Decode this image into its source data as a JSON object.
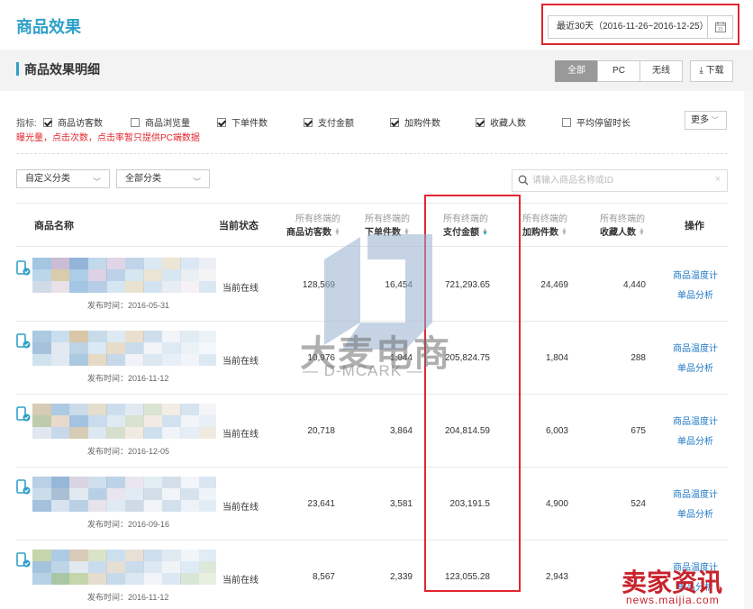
{
  "page_title": "商品效果",
  "date_range": "最近30天（2016-11-26~2016-12-25）",
  "section_title": "商品效果明细",
  "segment": {
    "all": "全部",
    "pc": "PC",
    "wireless": "无线"
  },
  "download_label": "下载",
  "indicators": {
    "label": "指标:",
    "items": [
      {
        "label": "商品访客数",
        "checked": true
      },
      {
        "label": "商品浏览量",
        "checked": false
      },
      {
        "label": "下单件数",
        "checked": true
      },
      {
        "label": "支付金额",
        "checked": true
      },
      {
        "label": "加购件数",
        "checked": true
      },
      {
        "label": "收藏人数",
        "checked": true
      },
      {
        "label": "平均停留时长",
        "checked": false
      }
    ],
    "more_label": "更多",
    "note": "曝光量，点击次数，点击率暂只提供PC端数据"
  },
  "filters": {
    "custom_category": "自定义分类",
    "all_category": "全部分类",
    "search_placeholder": "请输入商品名称或ID"
  },
  "columns": {
    "name": "商品名称",
    "status": "当前状态",
    "visitors": {
      "top": "所有终端的",
      "bottom": "商品访客数"
    },
    "orders": {
      "top": "所有终端的",
      "bottom": "下单件数"
    },
    "payment": {
      "top": "所有终端的",
      "bottom": "支付金额"
    },
    "cart": {
      "top": "所有终端的",
      "bottom": "加购件数"
    },
    "favorites": {
      "top": "所有终端的",
      "bottom": "收藏人数"
    },
    "actions": "操作"
  },
  "rows": [
    {
      "publish": "发布时间：2016-05-31",
      "status": "当前在线",
      "visitors": "128,569",
      "orders": "16,454",
      "payment": "721,293.65",
      "cart": "24,469",
      "favorites": "4,440",
      "action1": "商品温度计",
      "action2": "单品分析"
    },
    {
      "publish": "发布时间：2016-11-12",
      "status": "当前在线",
      "visitors": "10,976",
      "orders": "1,044",
      "payment": "205,824.75",
      "cart": "1,804",
      "favorites": "288",
      "action1": "商品温度计",
      "action2": "单品分析"
    },
    {
      "publish": "发布时间：2016-12-05",
      "status": "当前在线",
      "visitors": "20,718",
      "orders": "3,864",
      "payment": "204,814.59",
      "cart": "6,003",
      "favorites": "675",
      "action1": "商品温度计",
      "action2": "单品分析"
    },
    {
      "publish": "发布时间：2016-09-16",
      "status": "当前在线",
      "visitors": "23,641",
      "orders": "3,581",
      "payment": "203,191.5",
      "cart": "4,900",
      "favorites": "524",
      "action1": "商品温度计",
      "action2": "单品分析"
    },
    {
      "publish": "发布时间：2016-11-12",
      "status": "当前在线",
      "visitors": "8,567",
      "orders": "2,339",
      "payment": "123,055.28",
      "cart": "2,943",
      "favorites": "",
      "action1": "商品温度计",
      "action2": "单品分析"
    }
  ],
  "watermark": {
    "cn": "大麦电商",
    "en": "— D-MCARK —"
  },
  "corner_watermark": {
    "logo": "卖家资讯",
    "url": "news.maijia.com"
  },
  "colors": {
    "accent": "#2fa0c8",
    "link": "#1f78c4",
    "highlight_box": "#e0262f"
  },
  "icons": {
    "product": "mobile-check-icon",
    "calendar": "calendar-icon",
    "download": "download-icon",
    "search": "search-icon",
    "sort": "sort-icon"
  }
}
